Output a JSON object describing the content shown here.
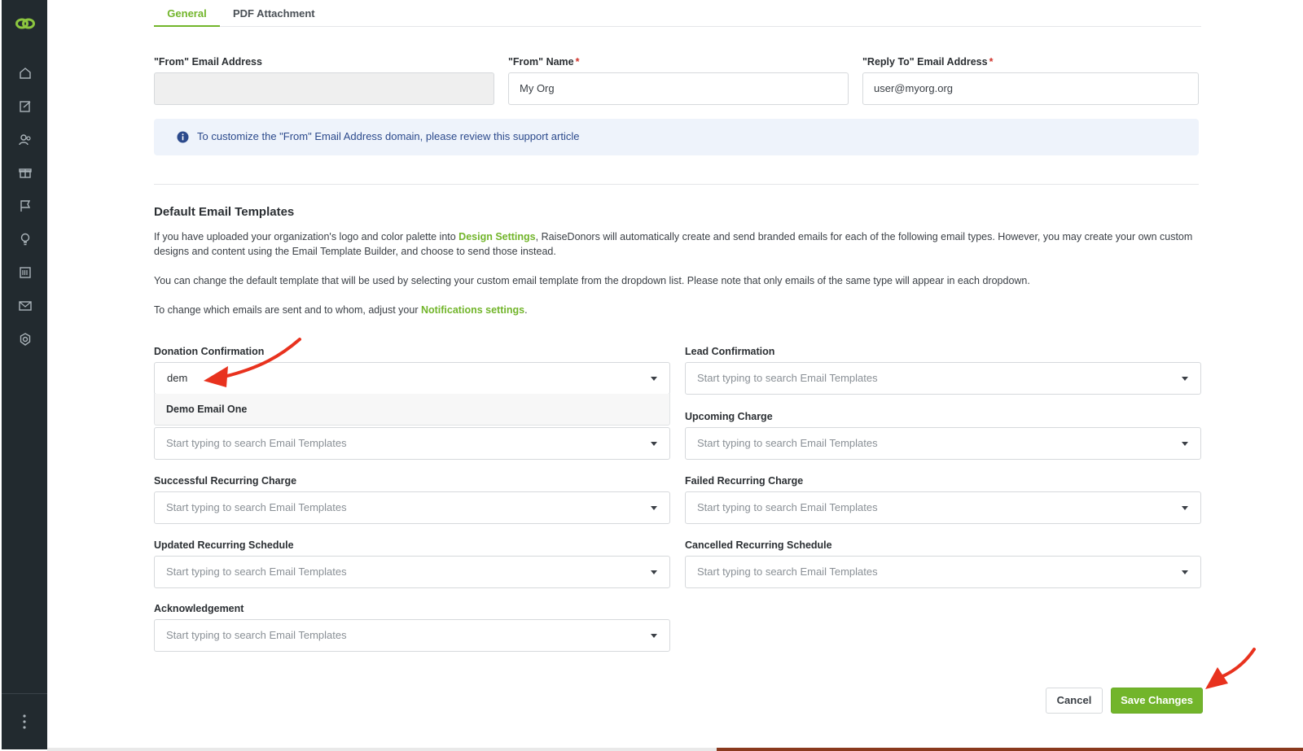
{
  "colors": {
    "accent": "#72b52b",
    "sidebar_bg": "#222a2f",
    "info_bg": "#eef3fb",
    "info_text": "#2c4a8c",
    "required": "#d0342c",
    "annotation_arrow": "#e8321e"
  },
  "sidebar": {
    "logo_icon": "link-logo-icon",
    "items": [
      {
        "icon": "home-icon"
      },
      {
        "icon": "edit-form-icon"
      },
      {
        "icon": "users-icon"
      },
      {
        "icon": "gift-icon"
      },
      {
        "icon": "flag-icon"
      },
      {
        "icon": "lightbulb-icon"
      },
      {
        "icon": "barcode-icon"
      },
      {
        "icon": "mail-check-icon"
      },
      {
        "icon": "settings-icon"
      }
    ],
    "more_icon": "vertical-dots-icon"
  },
  "tabs": [
    {
      "label": "General",
      "active": true
    },
    {
      "label": "PDF Attachment",
      "active": false
    }
  ],
  "from_email": {
    "label": "\"From\" Email Address",
    "value": ""
  },
  "from_name": {
    "label": "\"From\" Name",
    "required_mark": "*",
    "value": "My Org"
  },
  "reply_to": {
    "label": "\"Reply To\" Email Address",
    "required_mark": "*",
    "value": "user@myorg.org"
  },
  "info": {
    "text": "To customize the \"From\" Email Address domain, please review this support article"
  },
  "templates_section": {
    "title": "Default Email Templates",
    "para1_before": "If you have uploaded your organization's logo and color palette into ",
    "para1_link": "Design Settings",
    "para1_after": ", RaiseDonors will automatically create and send branded emails for each of the following email types. However, you may create your own custom designs and content using the Email Template Builder, and choose to send those instead.",
    "para2": "You can change the default template that will be used by selecting your custom email template from the dropdown list. Please note that only emails of the same type will appear in each dropdown.",
    "para3_before": "To change which emails are sent and to whom, adjust your ",
    "para3_link": "Notifications settings",
    "para3_after": "."
  },
  "placeholder": "Start typing to search Email Templates",
  "fields": {
    "donation_confirmation": {
      "label": "Donation Confirmation",
      "typed": "dem"
    },
    "lead_confirmation": {
      "label": "Lead Confirmation"
    },
    "upcoming_charge": {
      "label": "Upcoming Charge"
    },
    "successful_recurring": {
      "label": "Successful Recurring Charge"
    },
    "failed_recurring": {
      "label": "Failed Recurring Charge"
    },
    "updated_recurring": {
      "label": "Updated Recurring Schedule"
    },
    "cancelled_recurring": {
      "label": "Cancelled Recurring Schedule"
    },
    "acknowledgement": {
      "label": "Acknowledgement"
    }
  },
  "dropdown_options": [
    "Demo Email One"
  ],
  "actions": {
    "cancel": "Cancel",
    "save": "Save Changes"
  }
}
